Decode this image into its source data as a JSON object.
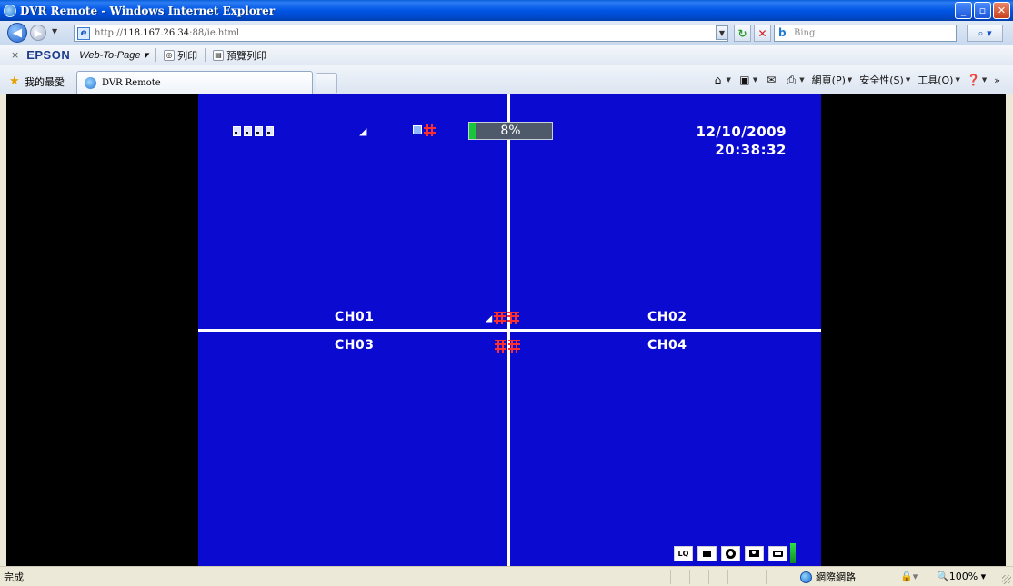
{
  "window": {
    "title": "DVR Remote - Windows Internet Explorer",
    "controls": [
      "minimize",
      "maximize",
      "close"
    ]
  },
  "address_bar": {
    "url_prefix": "http://",
    "url_host": "118.167.26.34",
    "url_rest": ":88/ie.html",
    "search_placeholder": "Bing"
  },
  "epson_toolbar": {
    "close": "×",
    "brand": "EPSON",
    "web_to_page": "Web-To-Page",
    "print": "列印",
    "preview_print": "預覽列印"
  },
  "favorites_bar": {
    "favorites_label": "我的最愛",
    "tab_title": "DVR Remote",
    "commands": {
      "page": "網頁(P)",
      "safety": "安全性(S)",
      "tools": "工具(O)"
    }
  },
  "dvr": {
    "hdd_usage_percent": 8,
    "hdd_usage_label": "8%",
    "date": "12/10/2009",
    "time": "20:38:32",
    "channels": [
      "CH01",
      "CH02",
      "CH03",
      "CH04"
    ],
    "toolbar": {
      "lq_label": "LQ"
    },
    "colors": {
      "background": "#0a0ad0",
      "record": "#ff2f2f",
      "usage_fill": "#19c63b"
    }
  },
  "status_bar": {
    "status": "完成",
    "zone": "網際網路",
    "zoom": "100%"
  }
}
